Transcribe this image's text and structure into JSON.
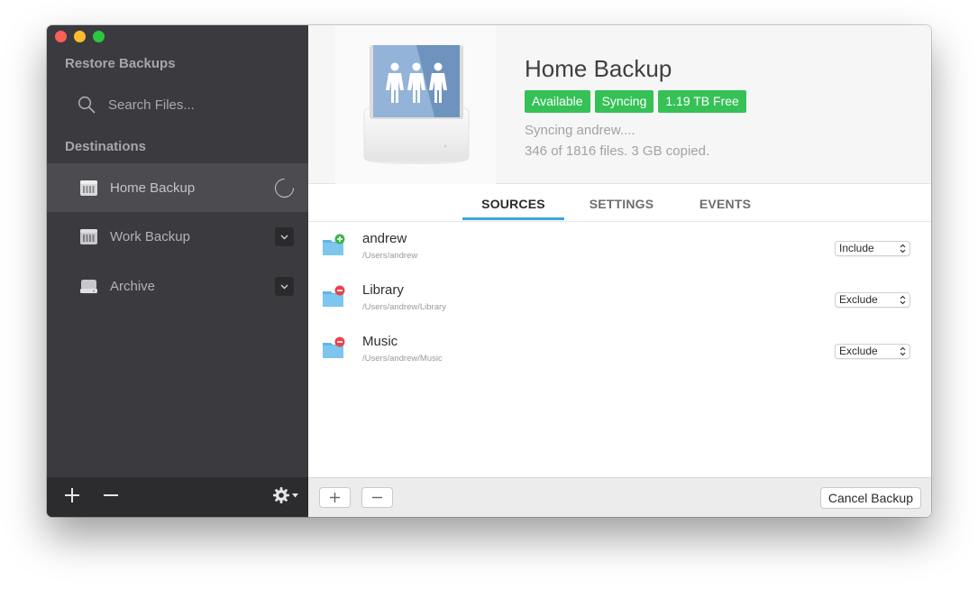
{
  "sidebar": {
    "restore_title": "Restore Backups",
    "search_placeholder": "Search Files...",
    "destinations_title": "Destinations",
    "items": [
      {
        "label": "Home Backup",
        "icon": "server-drive-icon",
        "state": "syncing"
      },
      {
        "label": "Work Backup",
        "icon": "server-drive-icon",
        "state": "idle"
      },
      {
        "label": "Archive",
        "icon": "external-drive-icon",
        "state": "idle"
      }
    ],
    "footer": {
      "add": "add-icon",
      "remove": "remove-icon",
      "settings": "gear-icon"
    }
  },
  "header": {
    "title": "Home Backup",
    "badges": [
      "Available",
      "Syncing",
      "1.19 TB Free"
    ],
    "status_line_1": "Syncing andrew....",
    "status_line_2": "346 of 1816 files. 3 GB copied."
  },
  "tabs": [
    "SOURCES",
    "SETTINGS",
    "EVENTS"
  ],
  "active_tab": "SOURCES",
  "sources": [
    {
      "name": "andrew",
      "path": "/Users/andrew",
      "mode": "Include",
      "badge": "add"
    },
    {
      "name": "Library",
      "path": "/Users/andrew/Library",
      "mode": "Exclude",
      "badge": "remove"
    },
    {
      "name": "Music",
      "path": "/Users/andrew/Music",
      "mode": "Exclude",
      "badge": "remove"
    }
  ],
  "footer": {
    "cancel_label": "Cancel Backup"
  },
  "colors": {
    "sidebar_bg": "#3b3b3f",
    "badge_green": "#36c157",
    "tab_accent": "#3aa7e0",
    "folder_blue": "#5fb6e6",
    "include_green": "#3cb34a",
    "exclude_red": "#e5454b"
  }
}
